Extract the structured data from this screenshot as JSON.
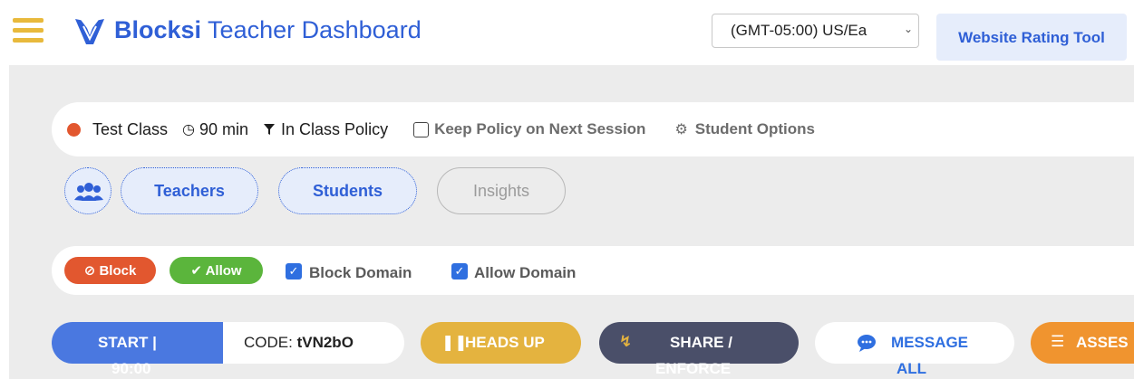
{
  "header": {
    "brand_bold": "Blocksi",
    "brand_rest": " Teacher Dashboard",
    "timezone": "(GMT-05:00) US/Ea",
    "rating_button": "Website Rating Tool",
    "colors": {
      "brand": "#2f5fd6",
      "menu": "#e8b93c"
    }
  },
  "session": {
    "class_name": "Test Class",
    "duration": "90 min",
    "policy": "In Class Policy",
    "keep_policy_label": "Keep Policy on Next Session",
    "student_options_label": "Student Options",
    "status_color": "#e2572f"
  },
  "tabs": {
    "teachers": "Teachers",
    "students": "Students",
    "insights": "Insights"
  },
  "domain": {
    "block_label": "Block",
    "allow_label": "Allow",
    "block_domain_label": "Block Domain",
    "allow_domain_label": "Allow Domain",
    "block_domain_checked": true,
    "allow_domain_checked": true
  },
  "actions": {
    "start": "START |",
    "start_time": "90:00",
    "code_label": "CODE:",
    "code_value": "tVN2bO",
    "heads_up": "HEADS UP",
    "share_line1": "SHARE /",
    "share_line2": "ENFORCE",
    "message_line1": "MESSAGE",
    "message_line2": "ALL",
    "assess": "ASSES"
  }
}
